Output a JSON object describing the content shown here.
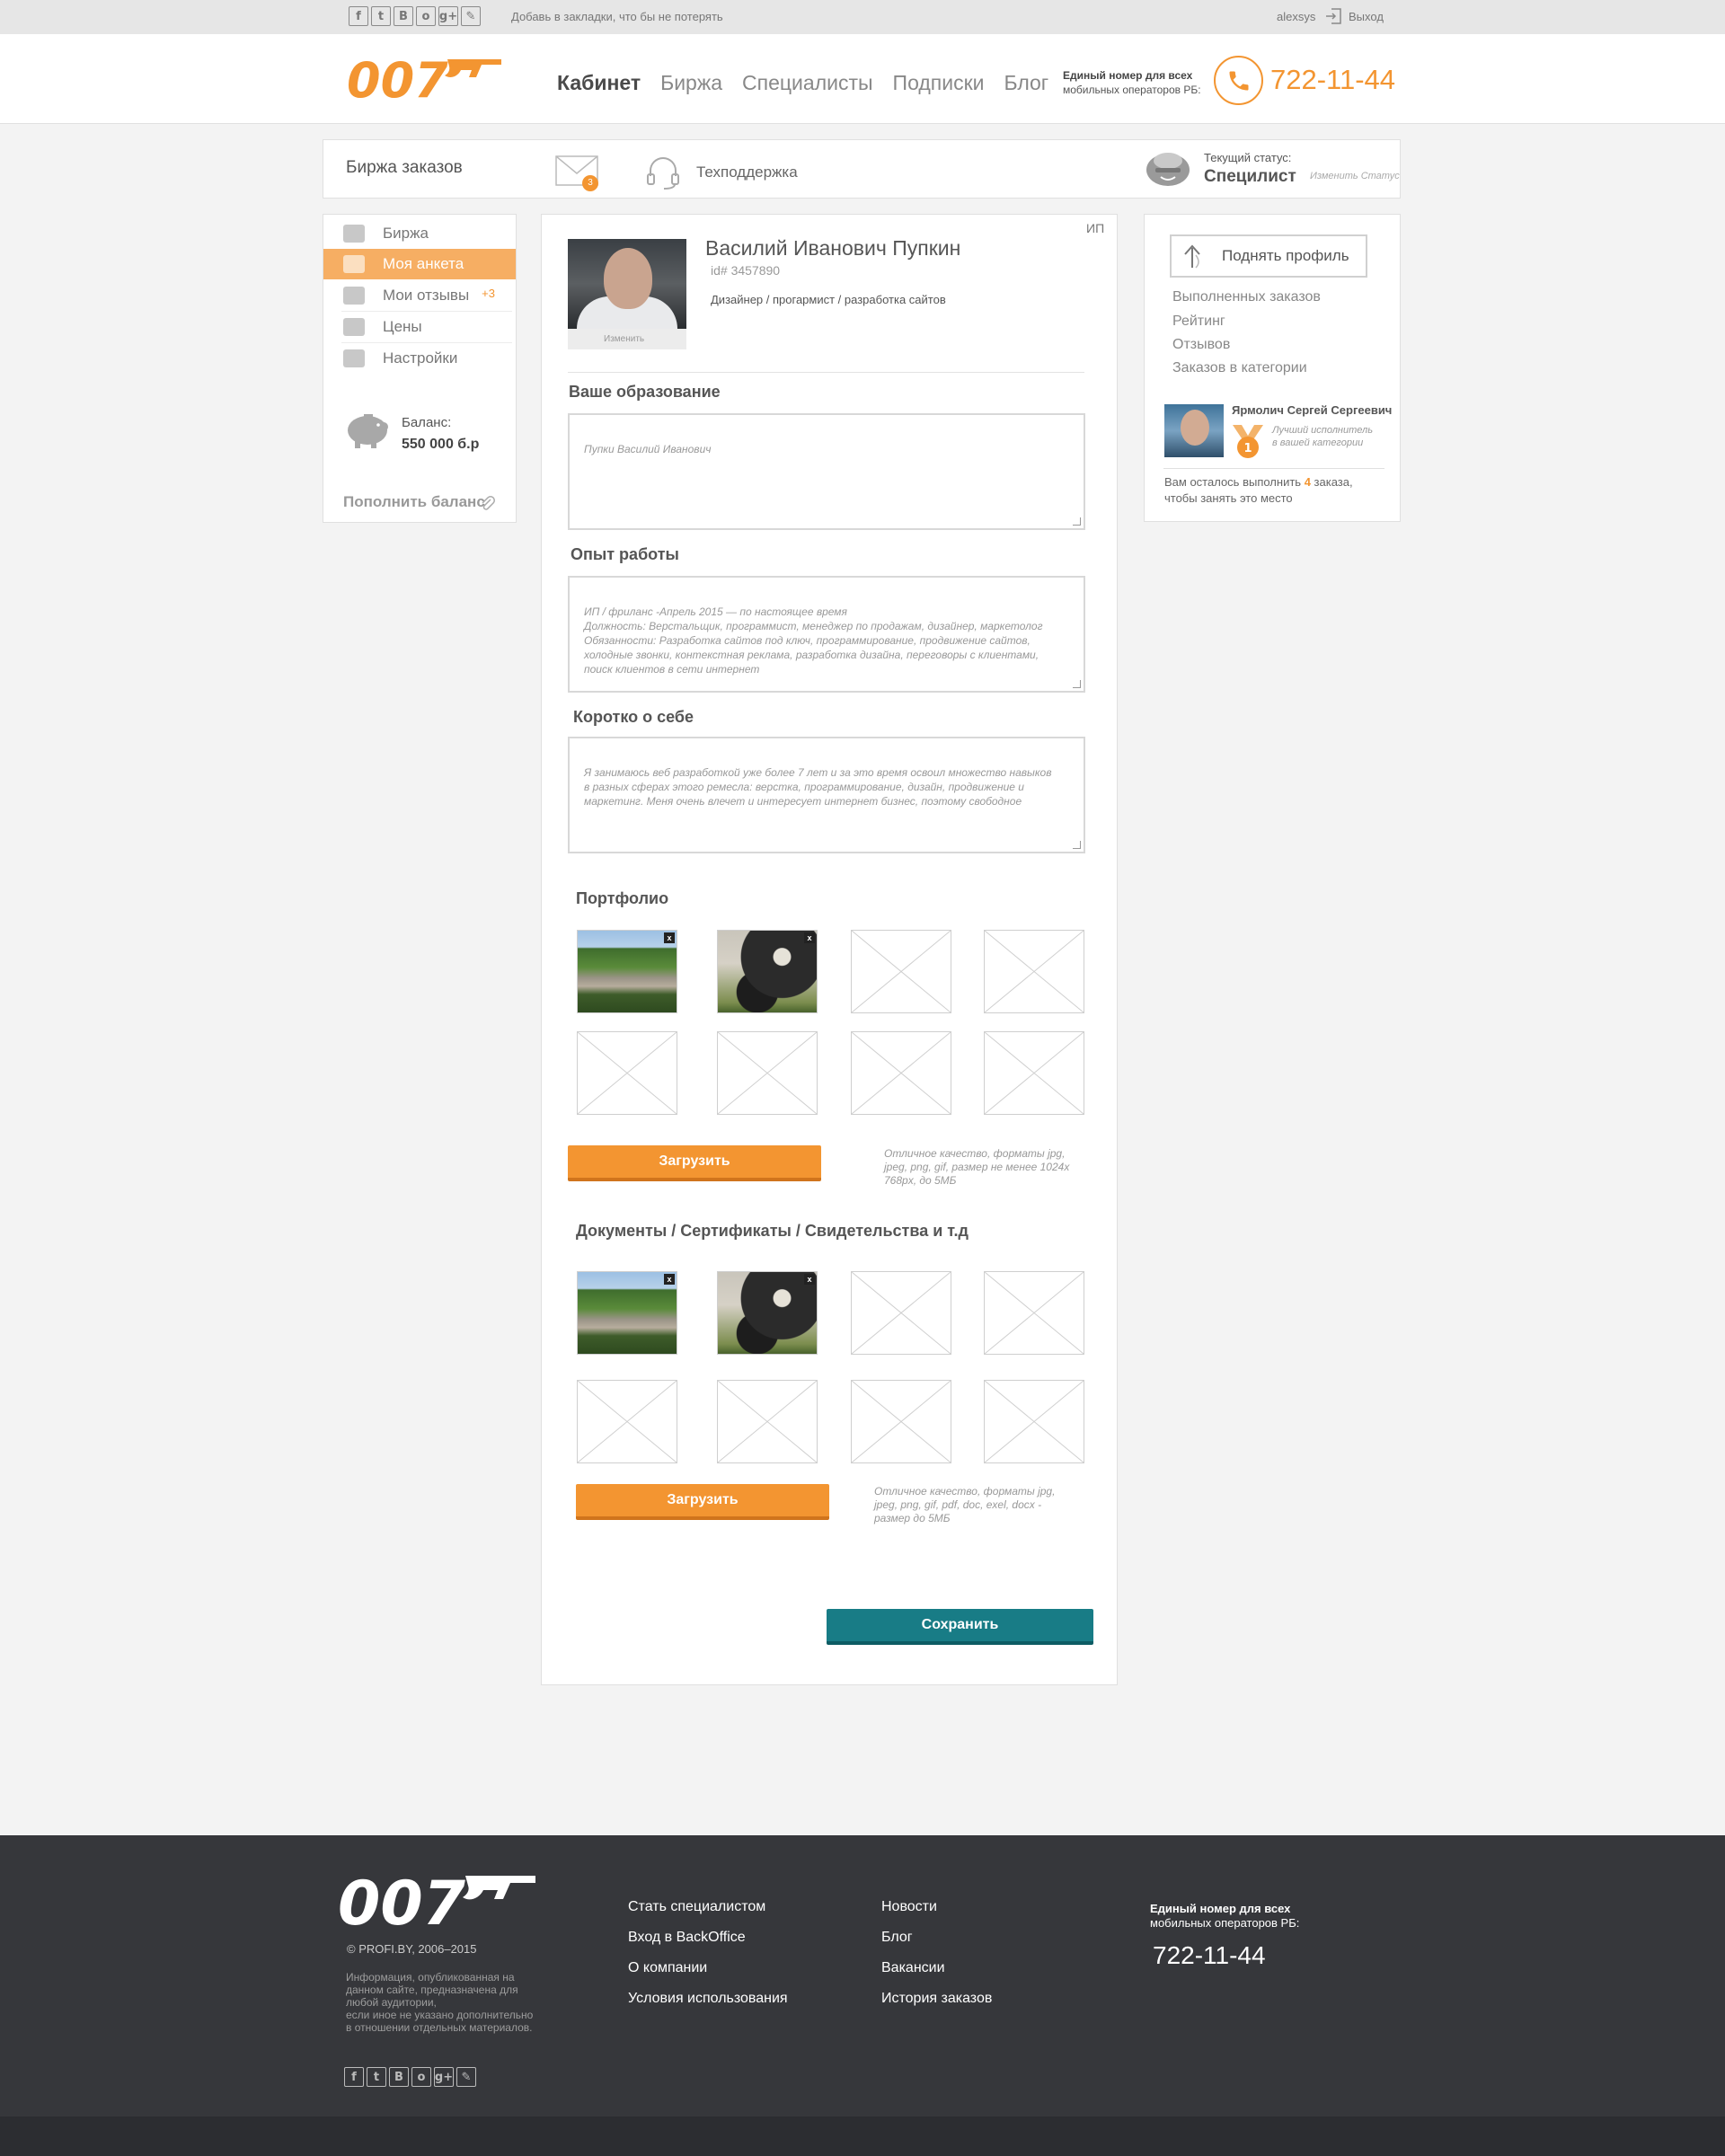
{
  "topbar": {
    "social": [
      "f",
      "t",
      "B",
      "o",
      "g+",
      "✎"
    ],
    "bookmark": "Добавь в закладки, что бы не потерять",
    "username": "alexsys",
    "exit": "Выход"
  },
  "header": {
    "logo": "007",
    "nav": [
      "Кабинет",
      "Биржа",
      "Специалисты",
      "Подписки",
      "Блог"
    ],
    "phone_caption_1": "Единый номер для всех",
    "phone_caption_2": "мобильных операторов РБ:",
    "phone": "722-11-44"
  },
  "subbar": {
    "title": "Биржа заказов",
    "mail_count": "3",
    "support": "Техподдержка",
    "status_caption": "Текущий статус:",
    "status_value": "Специлист",
    "status_change": "Изменить Статус"
  },
  "sidebar": {
    "items": [
      {
        "label": "Биржа",
        "icon": "plug-icon"
      },
      {
        "label": "Моя анкета",
        "icon": "profile-card-icon"
      },
      {
        "label": "Мои отзывы",
        "icon": "comment-icon",
        "badge": "+3"
      },
      {
        "label": "Цены",
        "icon": "price-list-icon"
      },
      {
        "label": "Настройки",
        "icon": "gear-icon"
      }
    ],
    "balance_caption": "Баланс:",
    "balance_value": "550 000 б.р",
    "topup": "Пополнить баланс"
  },
  "profile": {
    "ip": "ИП",
    "avatar_change": "Изменить",
    "name": "Василий Иванович Пупкин",
    "id": "id# 3457890",
    "profession": "Дизайнер / прогармист / разрaботка сайтов",
    "education_title": "Ваше образование",
    "education_placeholder": "Пупки Василий Иванович",
    "experience_title": "Опыт работы",
    "experience_text": "ИП / фриланс -Апрель 2015 — по настоящее время\nДолжность: Верстальщик, программист, менеджер по продажам, дизайнер, маркетолог\nОбязанности: Разработка сайтов под ключ, программирование, продвижение сайтов,\nхолодные звонки, контекстная реклама, разработка дизайна, переговоры с клиентами,\nпоиск клиентов в сети интернет",
    "about_title": "Коротко о себе",
    "about_text": "Я занимаюсь веб разработкой уже более 7 лет и за это время освоил множество навыков\nв разных сферах этого ремесла: верстка, программирование, дизайн, продвижение и\nмаркетинг. Меня очень влечет и интересует интернет бизнес, поэтому свободное",
    "portfolio_title": "Портфолио",
    "upload": "Загрузить",
    "portfolio_hint": "Отличное качество, форматы jpg,\njpeg, png, gif, размер не менее 1024x\n768px, до 5МБ",
    "docs_title": "Документы / Сертификаты / Свидетельства и т.д",
    "docs_hint": "Отличное качество, форматы jpg,\njpeg, png, gif, pdf, doc, exel, docx -\nразмер до 5МБ",
    "remove": "x",
    "save": "Сохранить"
  },
  "right": {
    "raise": "Поднять профиль",
    "stats": [
      "Выполненных заказов",
      "Рейтинг",
      "Отзывов",
      "Заказов в категории"
    ],
    "best_name": "Ярмолич Сергей Сергеевич",
    "best_sub": "Лучший исполнитель\nв вашей категории",
    "medal": "1",
    "left_pre": "Вам осталось выполнить",
    "left_count": "4",
    "left_post": "заказа,",
    "left_line2": "чтобы занять это место"
  },
  "footer": {
    "logo": "007",
    "copyright": "© PROFI.BY, 2006–2015",
    "info": "Информация, опубликованная на\nданном сайте, предназначена для\nлюбой аудитории,\nесли иное не указано дополнительно\nв отношении отдельных материалов.",
    "col1": [
      "Стать специалистом",
      "Вход в BackOffice",
      "О компании",
      "Условия использования"
    ],
    "col2": [
      "Новости",
      "Блог",
      "Вакансии",
      "История заказов"
    ],
    "phone_caption_1": "Единый номер для всех",
    "phone_caption_2": "мобильных операторов РБ:",
    "phone": "722-11-44"
  },
  "colors": {
    "accent": "#f39531",
    "save": "#187c86",
    "footer": "#36373b"
  }
}
